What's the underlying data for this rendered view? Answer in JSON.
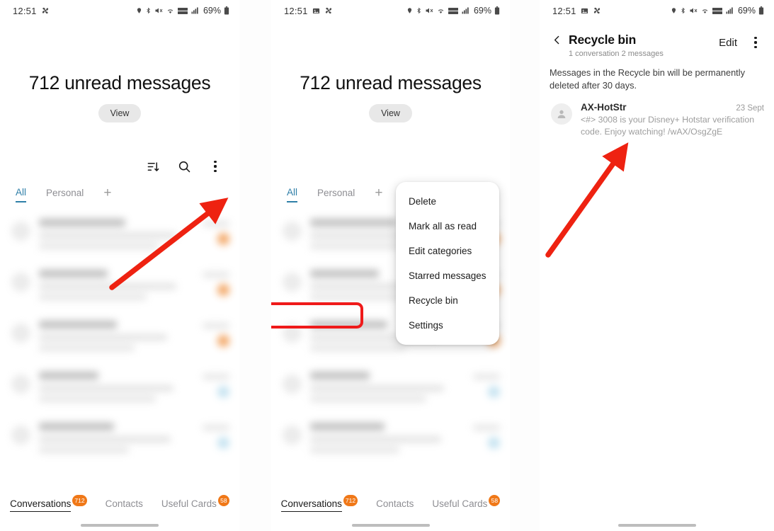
{
  "statusbar": {
    "time": "12:51",
    "battery": "69%",
    "icons_left_p1": [
      "fan-icon"
    ],
    "icons_left_p23": [
      "image-icon",
      "fan-icon"
    ],
    "icons_right": [
      "location-icon",
      "bluetooth-icon",
      "mute-icon",
      "wifi-icon",
      "volte-icon",
      "signal-icon"
    ]
  },
  "panel1": {
    "unread": {
      "title": "712 unread messages",
      "view_label": "View"
    },
    "toolbar": {
      "sort_icon": "sort-icon",
      "search_icon": "search-icon",
      "more_icon": "more-vertical-icon"
    },
    "category_tabs": [
      {
        "label": "All",
        "active": true
      },
      {
        "label": "Personal",
        "active": false
      }
    ],
    "add_category_label": "+",
    "bottom_nav": [
      {
        "label": "Conversations",
        "badge": "712",
        "active": true
      },
      {
        "label": "Contacts",
        "badge": "",
        "active": false
      },
      {
        "label": "Useful Cards",
        "badge": "58",
        "active": false
      }
    ]
  },
  "panel2": {
    "unread": {
      "title": "712 unread messages",
      "view_label": "View"
    },
    "category_tabs": [
      {
        "label": "All",
        "active": true
      },
      {
        "label": "Personal",
        "active": false
      }
    ],
    "add_category_label": "+",
    "menu_items": [
      {
        "label": "Delete",
        "highlighted": false
      },
      {
        "label": "Mark all as read",
        "highlighted": false
      },
      {
        "label": "Edit categories",
        "highlighted": false
      },
      {
        "label": "Starred messages",
        "highlighted": false
      },
      {
        "label": "Recycle bin",
        "highlighted": true
      },
      {
        "label": "Settings",
        "highlighted": false
      }
    ],
    "bottom_nav": [
      {
        "label": "Conversations",
        "badge": "712",
        "active": true
      },
      {
        "label": "Contacts",
        "badge": "",
        "active": false
      },
      {
        "label": "Useful Cards",
        "badge": "58",
        "active": false
      }
    ]
  },
  "panel3": {
    "header": {
      "back_icon": "chevron-left-icon",
      "title": "Recycle bin",
      "subtitle": "1 conversation 2 messages",
      "edit_label": "Edit",
      "more_icon": "more-vertical-icon"
    },
    "notice": "Messages in the Recycle bin will be permanently deleted after 30 days.",
    "messages": [
      {
        "sender": "AX-HotStr",
        "date": "23 Sept",
        "preview": "<#> 3008 is your Disney+ Hotstar verification code. Enjoy watching! /wAX/OsgZgE",
        "avatar_icon": "person-icon"
      }
    ]
  },
  "annotations": {
    "arrow_color": "#ee2211",
    "highlight_color": "#ef1a1a",
    "arrows": [
      {
        "name": "arrow-to-more-menu",
        "target": "more-vertical-icon"
      },
      {
        "name": "arrow-to-recycle-bin-message",
        "target": "message-row"
      }
    ]
  },
  "colors": {
    "accent_tab": "#2f7fa8",
    "badge_orange": "#f07818",
    "pill_bg": "#e8e8e8"
  }
}
